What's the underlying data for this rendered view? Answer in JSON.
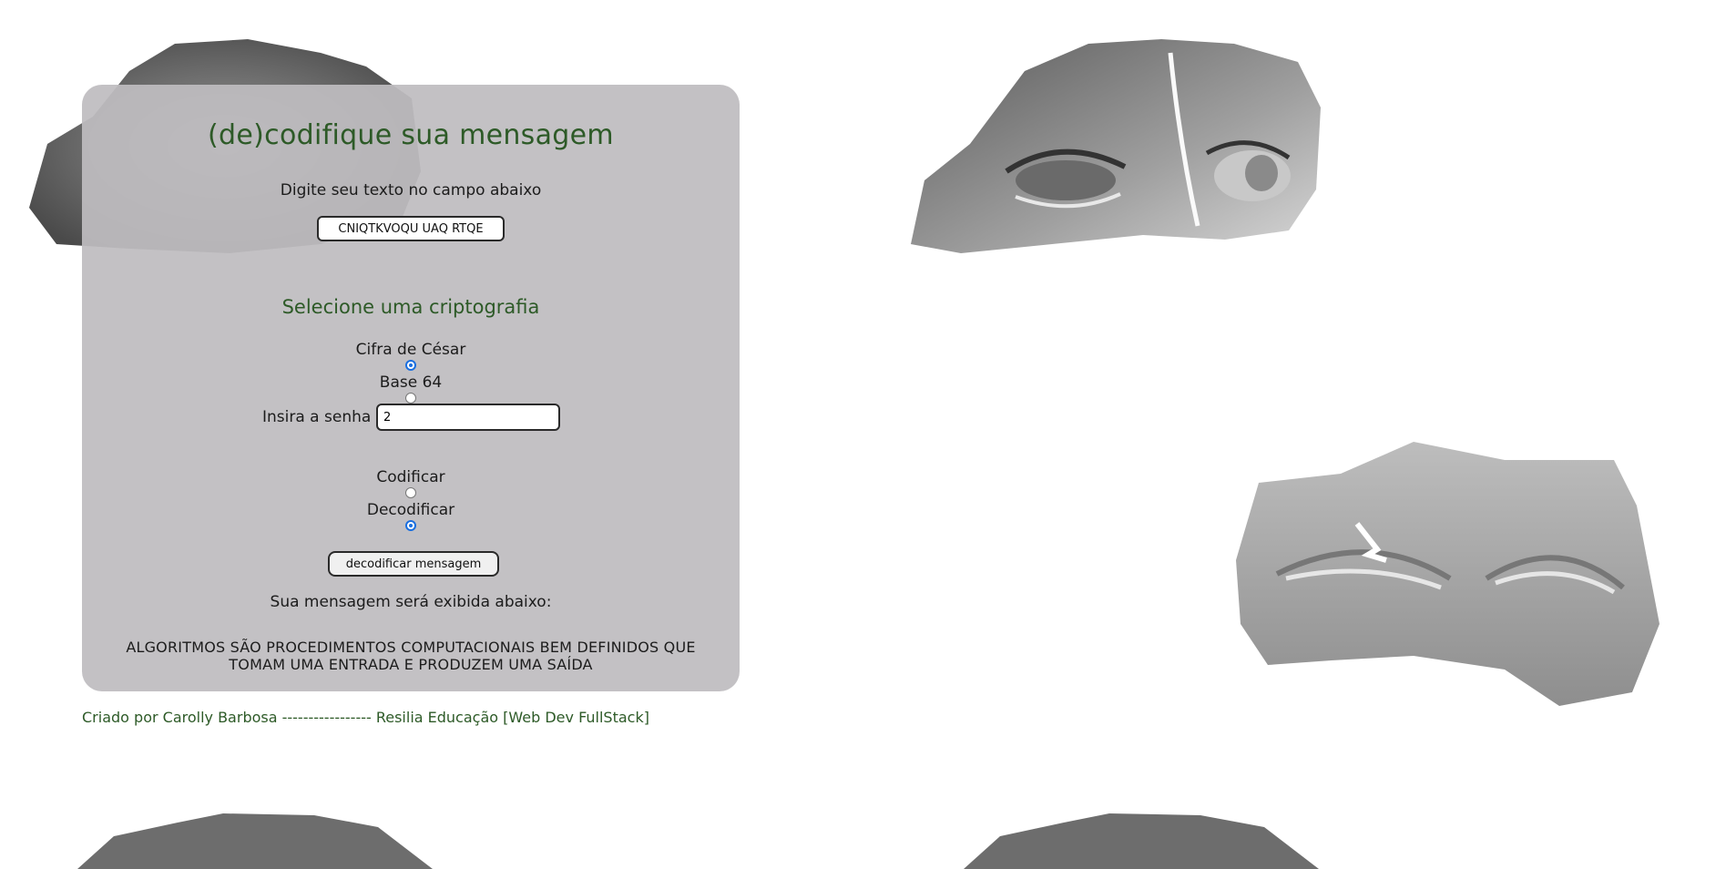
{
  "header": {
    "title": "(de)codifique sua mensagem"
  },
  "form": {
    "instruction": "Digite seu texto no campo abaixo",
    "message_value": "CNIQTKVOQU UÃQ RTQE",
    "cipher_heading": "Selecione uma criptografia",
    "cipher_options": [
      {
        "label": "Cifra de César",
        "checked": true
      },
      {
        "label": "Base 64",
        "checked": false
      }
    ],
    "password_label": "Insira a senha",
    "password_value": "2",
    "mode_options": [
      {
        "label": "Codificar",
        "checked": false
      },
      {
        "label": "Decodificar",
        "checked": true
      }
    ],
    "submit_label": "decodificar mensagem",
    "result_label": "Sua mensagem será exibida abaixo:",
    "result_text": "ALGORITMOS SÃO PROCEDIMENTOS COMPUTACIONAIS BEM DEFINIDOS QUE TOMAM UMA ENTRADA E PRODUZEM UMA SAÍDA"
  },
  "footer": {
    "credit": "Criado por Carolly Barbosa ----------------- Resilia Educação [Web Dev FullStack]"
  },
  "decor": {
    "background_images": [
      "sculpture-eyes-open",
      "sculpture-eyes-closed"
    ]
  },
  "colors": {
    "accent_green": "#2d5a27",
    "card_bg": "#bebcbf",
    "radio_checked": "#1a6fe0"
  }
}
